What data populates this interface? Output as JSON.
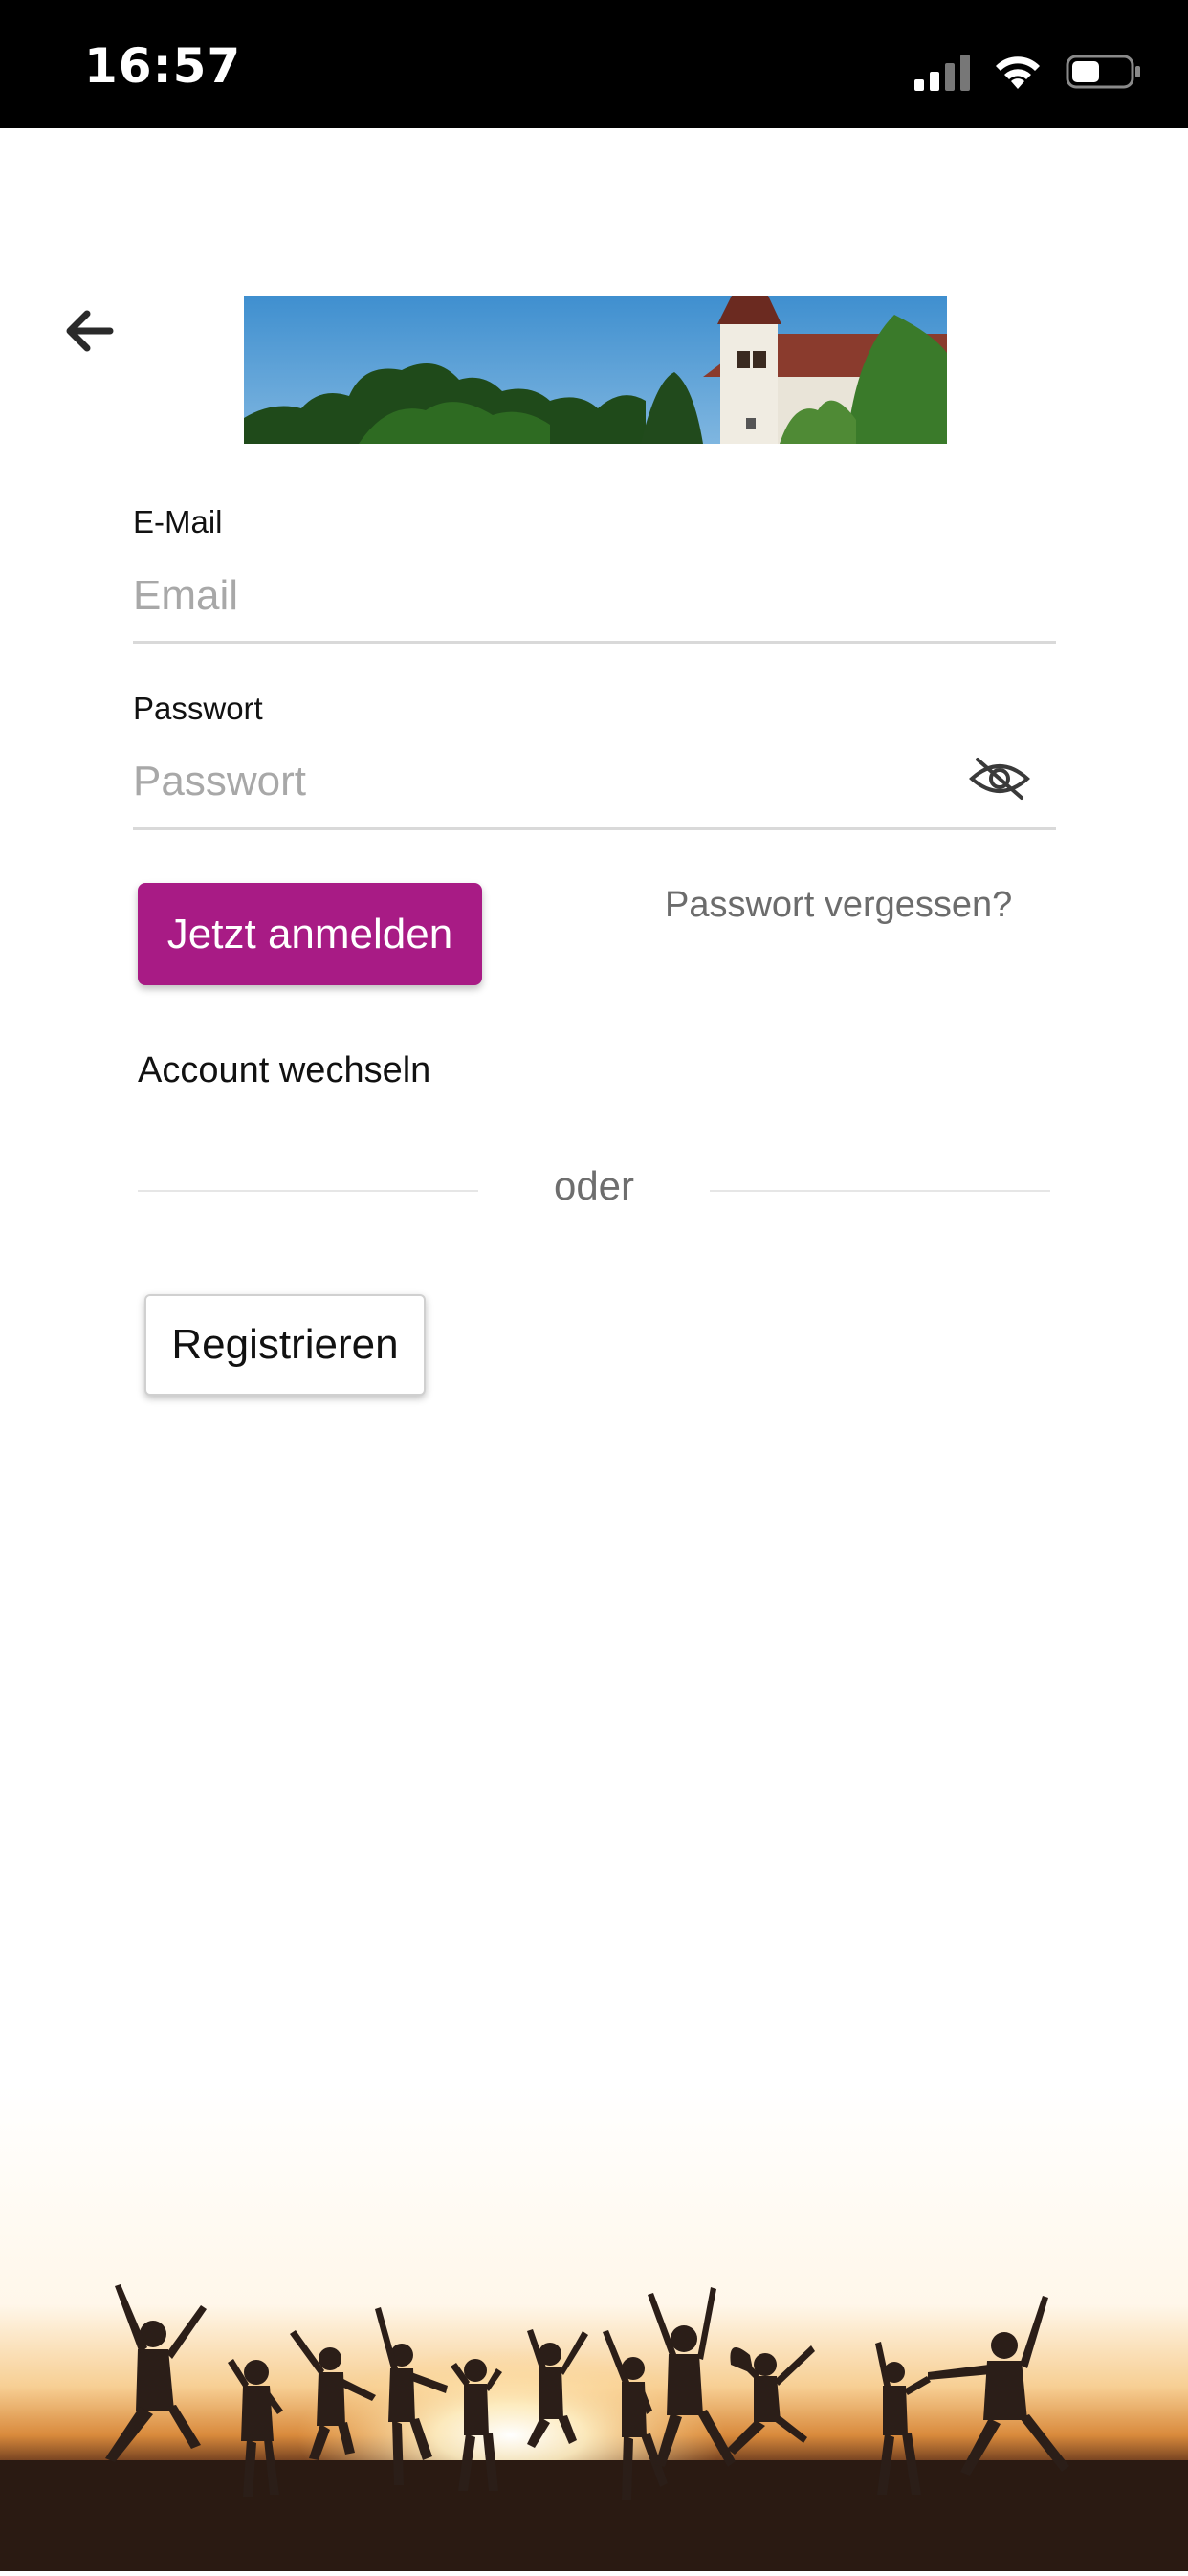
{
  "status_bar": {
    "time": "16:57",
    "icons": [
      "cellular-signal-icon",
      "wifi-icon",
      "battery-icon"
    ]
  },
  "header": {
    "back_icon": "arrow-left-icon",
    "banner_image": "church-on-hill-banner"
  },
  "form": {
    "email_label": "E-Mail",
    "email_placeholder": "Email",
    "email_value": "",
    "password_label": "Passwort",
    "password_placeholder": "Passwort",
    "password_value": "",
    "password_toggle_icon": "eye-off-icon",
    "login_button": "Jetzt anmelden",
    "forgot_link": "Passwort vergessen?",
    "switch_account": "Account wechseln",
    "divider_text": "oder",
    "register_button": "Registrieren"
  },
  "footer": {
    "image": "people-jumping-at-sunset"
  },
  "colors": {
    "accent": "#a81b85",
    "status_bar_bg": "#000000",
    "muted_text": "#6c6c6c"
  }
}
